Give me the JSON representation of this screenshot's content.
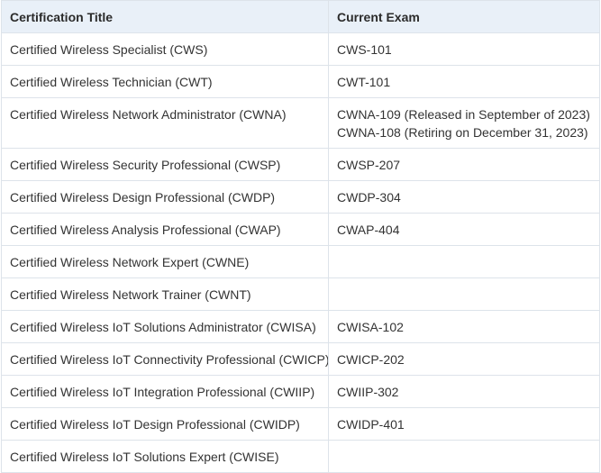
{
  "table": {
    "headers": [
      "Certification Title",
      "Current Exam"
    ],
    "rows": [
      {
        "title": "Certified Wireless Specialist (CWS)",
        "exams": [
          "CWS-101"
        ]
      },
      {
        "title": "Certified Wireless Technician (CWT)",
        "exams": [
          "CWT-101"
        ]
      },
      {
        "title": "Certified Wireless Network Administrator (CWNA)",
        "exams": [
          "CWNA-109 (Released in September of 2023)",
          "CWNA-108 (Retiring on December 31, 2023)"
        ]
      },
      {
        "title": "Certified Wireless Security Professional (CWSP)",
        "exams": [
          "CWSP-207"
        ]
      },
      {
        "title": "Certified Wireless Design Professional (CWDP)",
        "exams": [
          "CWDP-304"
        ]
      },
      {
        "title": "Certified Wireless Analysis Professional (CWAP)",
        "exams": [
          "CWAP-404"
        ]
      },
      {
        "title": "Certified Wireless Network Expert (CWNE)",
        "exams": []
      },
      {
        "title": "Certified Wireless Network Trainer (CWNT)",
        "exams": []
      },
      {
        "title": "Certified Wireless IoT Solutions Administrator (CWISA)",
        "exams": [
          "CWISA-102"
        ]
      },
      {
        "title": "Certified Wireless IoT Connectivity Professional (CWICP)",
        "exams": [
          "CWICP-202"
        ]
      },
      {
        "title": "Certified Wireless IoT Integration Professional (CWIIP)",
        "exams": [
          "CWIIP-302"
        ]
      },
      {
        "title": "Certified Wireless IoT Design Professional (CWIDP)",
        "exams": [
          "CWIDP-401"
        ]
      },
      {
        "title": "Certified Wireless IoT Solutions Expert (CWISE)",
        "exams": []
      }
    ]
  }
}
